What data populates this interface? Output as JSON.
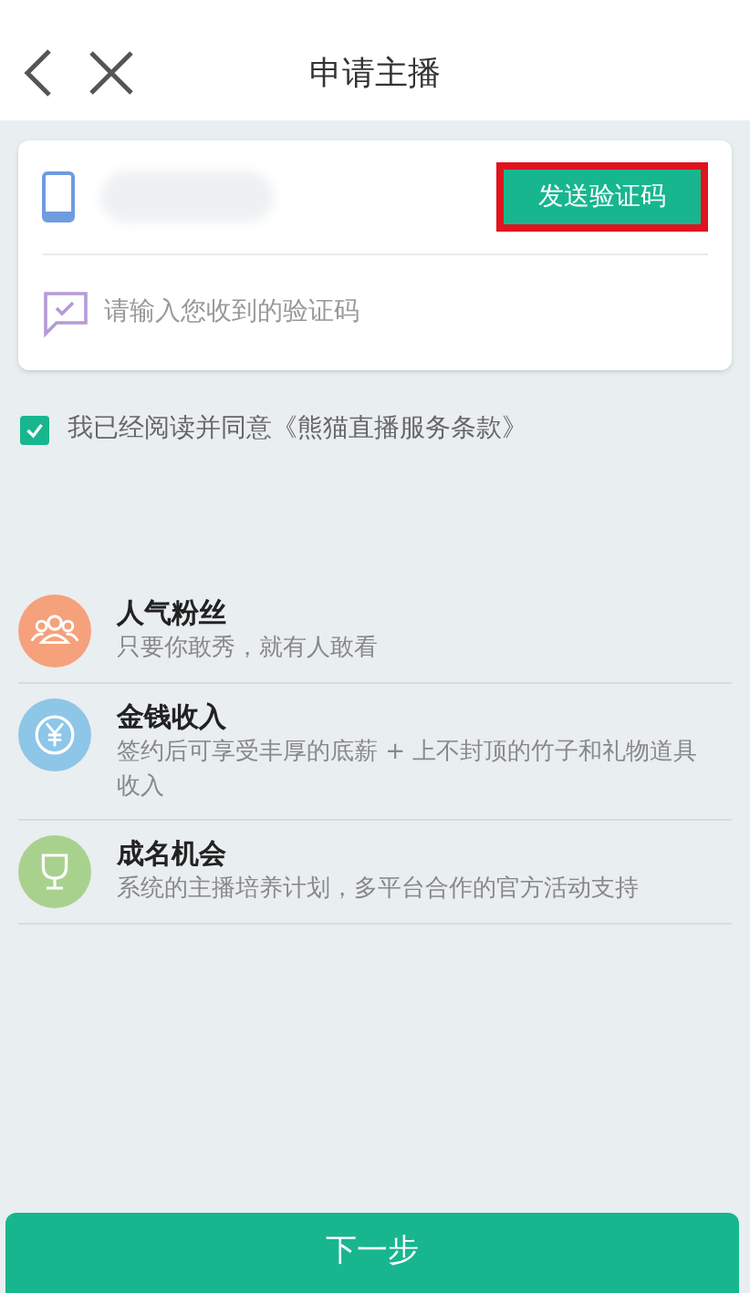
{
  "nav": {
    "title": "申请主播"
  },
  "form": {
    "send_code_button": "发送验证码",
    "code_placeholder": "请输入您收到的验证码"
  },
  "agreement": {
    "checked": true,
    "text": "我已经阅读并同意《熊猫直播服务条款》"
  },
  "features": [
    {
      "kind": "fans",
      "color": "#f5a17c",
      "title": "人气粉丝",
      "description": "只要你敢秀，就有人敢看"
    },
    {
      "kind": "income",
      "color": "#8ec6e8",
      "title": "金钱收入",
      "description": "签约后可享受丰厚的底薪 + 上不封顶的竹子和礼物道具收入"
    },
    {
      "kind": "fame",
      "color": "#a9d18e",
      "title": "成名机会",
      "description": "系统的主播培养计划，多平台合作的官方活动支持"
    }
  ],
  "next_button": "下一步"
}
